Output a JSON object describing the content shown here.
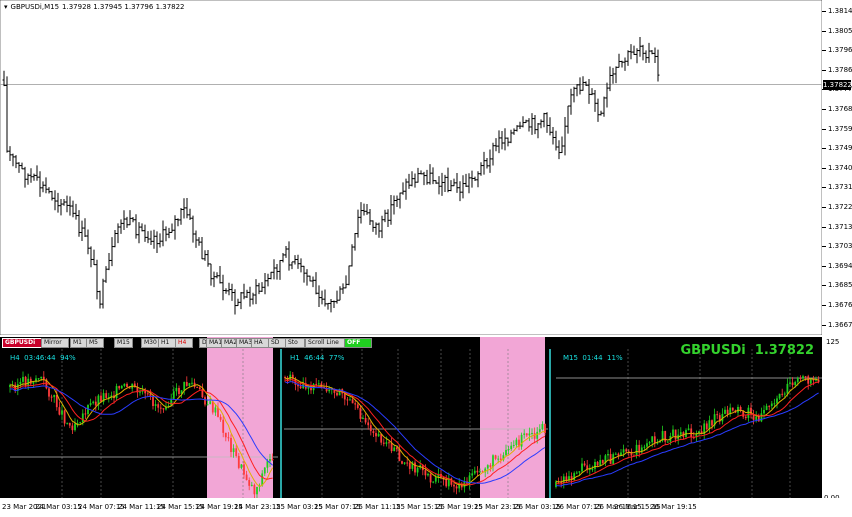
{
  "header": {
    "symbol_timeframe": "GBPUSDi,M15",
    "ohlc": "1.37928 1.37945 1.37796 1.37822"
  },
  "price_axis": {
    "labels": [
      "1.38140",
      "1.38050",
      "1.37960",
      "1.37865",
      "1.37775",
      "1.37680",
      "1.37590",
      "1.37495",
      "1.37405",
      "1.37315",
      "1.37220",
      "1.37130",
      "1.37035",
      "1.36945",
      "1.36855",
      "1.36760",
      "1.36670"
    ],
    "current": "1.37822"
  },
  "toolbar": {
    "buttons": [
      "GBPUSDi",
      "Mirror",
      "M1",
      "M5",
      "M15",
      "M30",
      "H1",
      "H4",
      "D1",
      "W1",
      "MN",
      "MA1",
      "MA2",
      "MA3",
      "HA",
      "SD",
      "Sto",
      "Scroll Line",
      "OFF"
    ]
  },
  "panels": [
    {
      "timeframe": "H4",
      "timer": "03:46:44",
      "percent": "94%"
    },
    {
      "timeframe": "H1",
      "timer": "46:44",
      "percent": "77%"
    },
    {
      "timeframe": "M15",
      "timer": "01:44",
      "percent": "11%"
    }
  ],
  "big_label": {
    "symbol": "GBPUSDi",
    "price": "1.37822"
  },
  "sub_axis": {
    "top": "125",
    "bottom": "0.00"
  },
  "time_axis": {
    "labels": [
      "23 Mar 2021",
      "24 Mar 03:15",
      "24 Mar 07:15",
      "24 Mar 11:15",
      "24 Mar 15:15",
      "24 Mar 19:15",
      "24 Mar 23:15",
      "25 Mar 03:15",
      "25 Mar 07:15",
      "25 Mar 11:15",
      "25 Mar 15:15",
      "25 Mar 19:15",
      "25 Mar 23:15",
      "26 Mar 03:15",
      "26 Mar 07:15",
      "26 Mar 11:15",
      "26 Mar 15:15",
      "26 Mar 19:15"
    ]
  },
  "colors": {
    "up": "#1fd11f",
    "down": "#ff3b3b",
    "ma_red": "#ff2020",
    "ma_blue": "#2a3cff",
    "ma_yellow": "#e0b000",
    "highlight": "#f2a6d6",
    "cyan": "#19e0e0"
  }
}
